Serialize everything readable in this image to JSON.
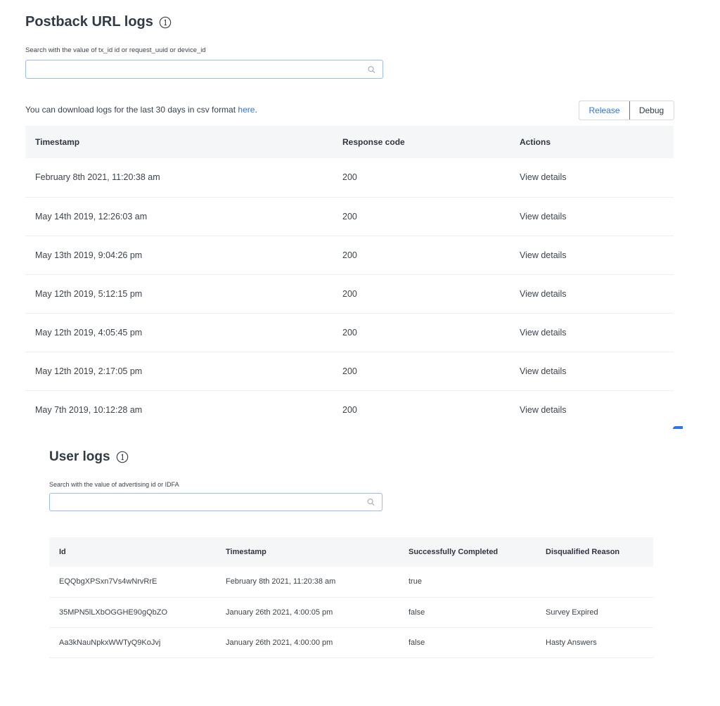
{
  "postback": {
    "title": "Postback URL logs",
    "search_label": "Search with the value of tx_id id or request_uuid or device_id",
    "search_value": "",
    "download_note": "You can download logs for the last 30 days in csv format",
    "download_link": "here",
    "download_suffix": ".",
    "toggle": {
      "release": "Release",
      "debug": "Debug",
      "selected": "Release"
    },
    "columns": [
      "Timestamp",
      "Response code",
      "Actions"
    ],
    "rows": [
      {
        "timestamp": "February 8th 2021, 11:20:38 am",
        "code": "200",
        "action": "View details"
      },
      {
        "timestamp": "May 14th 2019, 12:26:03 am",
        "code": "200",
        "action": "View details"
      },
      {
        "timestamp": "May 13th 2019, 9:04:26 pm",
        "code": "200",
        "action": "View details"
      },
      {
        "timestamp": "May 12th 2019, 5:12:15 pm",
        "code": "200",
        "action": "View details"
      },
      {
        "timestamp": "May 12th 2019, 4:05:45 pm",
        "code": "200",
        "action": "View details"
      },
      {
        "timestamp": "May 12th 2019, 2:17:05 pm",
        "code": "200",
        "action": "View details"
      },
      {
        "timestamp": "May 7th 2019, 10:12:28 am",
        "code": "200",
        "action": "View details"
      }
    ]
  },
  "userlogs": {
    "title": "User logs",
    "search_label": "Search with the value of advertising id or IDFA",
    "search_value": "",
    "columns": [
      "Id",
      "Timestamp",
      "Successfully Completed",
      "Disqualified Reason"
    ],
    "rows": [
      {
        "id": "EQQbgXPSxn7Vs4wNrvRrE",
        "timestamp": "February 8th 2021, 11:20:38 am",
        "completed": "true",
        "reason": ""
      },
      {
        "id": "35MPN5lLXbOGGHE90gQbZO",
        "timestamp": "January 26th 2021, 4:00:05 pm",
        "completed": "false",
        "reason": "Survey Expired"
      },
      {
        "id": "Aa3kNauNpkxWWTyQ9KoJvj",
        "timestamp": "January 26th 2021, 4:00:00 pm",
        "completed": "false",
        "reason": "Hasty Answers"
      }
    ]
  },
  "colors": {
    "accent": "#2f74e8",
    "success": "#3cb34a",
    "error": "#e0525b",
    "header_bg": "#f5f6f8"
  },
  "icons": {
    "info": "info-circle-icon",
    "search": "search-icon"
  }
}
